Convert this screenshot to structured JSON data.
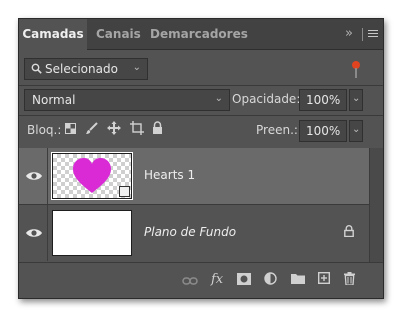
{
  "tabs": [
    "Camadas",
    "Canais",
    "Demarcadores"
  ],
  "tab_collapse": "»",
  "filter": {
    "value": "Selecionado",
    "chev": "⌄"
  },
  "blend": {
    "value": "Normal"
  },
  "opacity": {
    "label": "Opacidade:",
    "value": "100%"
  },
  "lock": {
    "label": "Bloq.:"
  },
  "fill": {
    "label": "Preen.:",
    "value": "100%"
  },
  "layers": [
    {
      "name": "Hearts 1",
      "selected": true
    },
    {
      "name": "Plano de Fundo",
      "locked": true
    }
  ],
  "colors": {
    "panel": "#535353",
    "selected_row": "#6a6a6a",
    "heart": "#d92ad6",
    "filter_toggle": "#e0431f"
  },
  "icons": [
    "link-icon",
    "fx-icon",
    "mask-icon",
    "adjustment-icon",
    "folder-icon",
    "new-layer-icon",
    "trash-icon"
  ],
  "bottom_fx": "fx"
}
